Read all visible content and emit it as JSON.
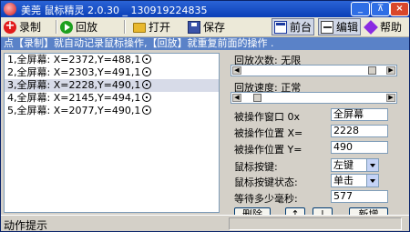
{
  "window": {
    "title": "美莞 鼠标精灵 2.0.30  _ 130919224835"
  },
  "toolbar": {
    "record": "录制",
    "play": "回放",
    "open": "打开",
    "save": "保存",
    "front": "前台",
    "edit": "编辑",
    "help": "帮助"
  },
  "hint": "点【录制】就自动记录鼠标操作,【回放】就重复前面的操作 .",
  "actions": [
    "1,全屏幕: X=2372,Y=488,1",
    "2,全屏幕: X=2303,Y=491,1",
    "3,全屏幕: X=2228,Y=490,1",
    "4,全屏幕: X=2145,Y=494,1",
    "5,全屏幕: X=2077,Y=490,1"
  ],
  "panel": {
    "repeat_label": "回放次数:",
    "repeat_value": "无限",
    "speed_label": "回放速度:",
    "speed_value": "正常",
    "window_label": "被操作窗口 0x",
    "window_value": "全屏幕",
    "pos_x_label": "被操作位置 X=",
    "pos_x_value": "2228",
    "pos_y_label": "被操作位置 Y=",
    "pos_y_value": "490",
    "button_label": "鼠标按键:",
    "button_value": "左键",
    "state_label": "鼠标按键状态:",
    "state_value": "单击",
    "wait_label": "等待多少毫秒:",
    "wait_value": "577",
    "delete_label": "删除",
    "up_label": "↑",
    "down_label": "↓",
    "add_label": "新增"
  },
  "status": {
    "text": "动作提示"
  }
}
